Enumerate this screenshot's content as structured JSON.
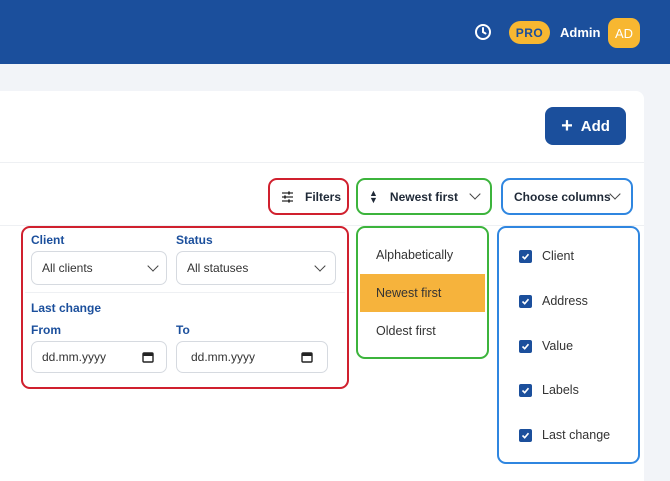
{
  "header": {
    "pro_badge": "PRO",
    "user_name": "Admin",
    "avatar_initials": "AD"
  },
  "toolbar": {
    "add_label": "Add",
    "filters_label": "Filters",
    "sort_label": "Newest first",
    "columns_label": "Choose columns"
  },
  "filters": {
    "client_label": "Client",
    "client_value": "All clients",
    "status_label": "Status",
    "status_value": "All statuses",
    "last_change_label": "Last change",
    "from_label": "From",
    "from_placeholder": "dd.mm.yyyy",
    "to_label": "To",
    "to_placeholder": "dd.mm.yyyy"
  },
  "sort_menu": {
    "items": [
      {
        "label": "Alphabetically",
        "active": false
      },
      {
        "label": "Newest first",
        "active": true
      },
      {
        "label": "Oldest first",
        "active": false
      }
    ]
  },
  "columns_menu": {
    "items": [
      {
        "label": "Client",
        "checked": true
      },
      {
        "label": "Address",
        "checked": true
      },
      {
        "label": "Value",
        "checked": true
      },
      {
        "label": "Labels",
        "checked": true
      },
      {
        "label": "Last change",
        "checked": true
      }
    ]
  },
  "colors": {
    "brand": "#1b4f9c",
    "accent": "#f7b731",
    "highlight_red": "#d0202e",
    "highlight_green": "#3cb43c",
    "highlight_blue": "#2f86e0"
  }
}
